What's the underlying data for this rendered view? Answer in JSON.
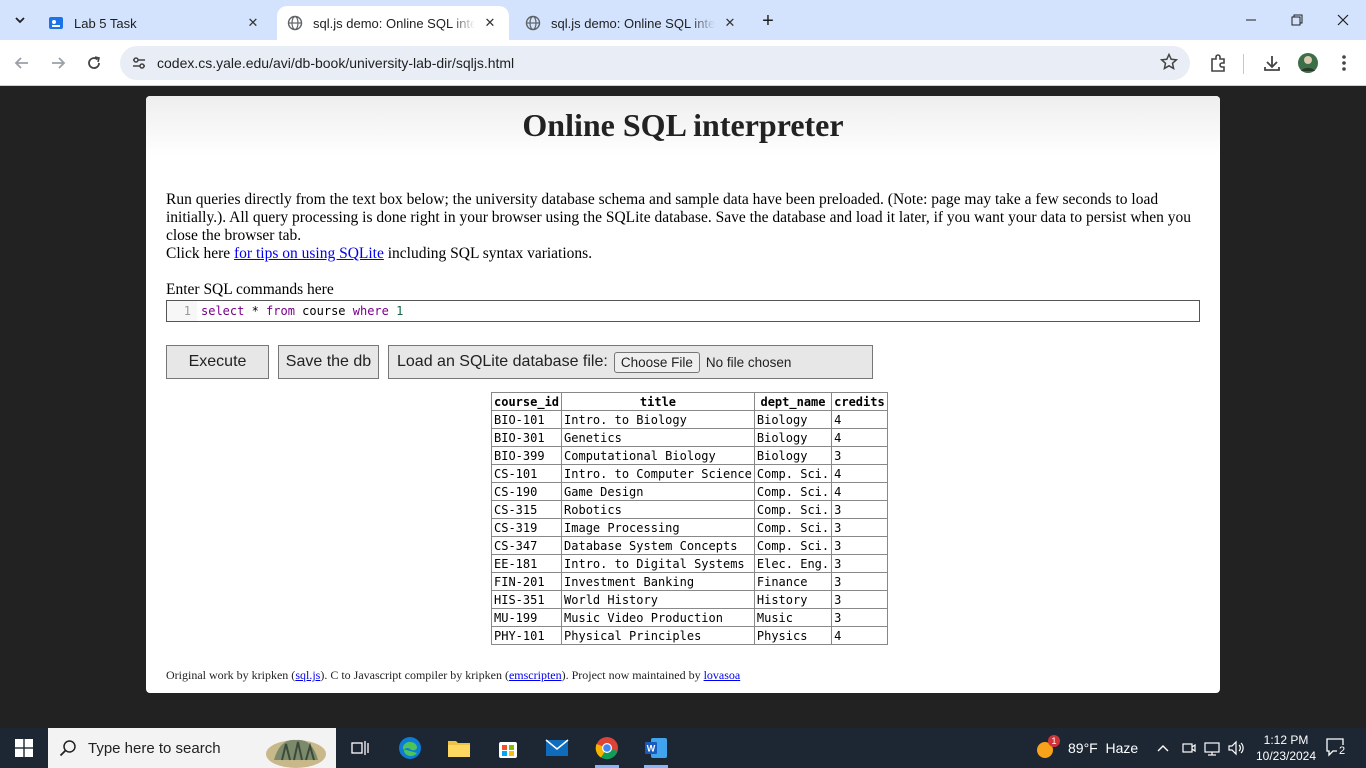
{
  "browser": {
    "tabs": [
      {
        "label": "Lab 5 Task",
        "active": false
      },
      {
        "label": "sql.js demo: Online SQL interpreter",
        "active": true
      },
      {
        "label": "sql.js demo: Online SQL interpreter",
        "active": false
      }
    ],
    "url": "codex.cs.yale.edu/avi/db-book/university-lab-dir/sqljs.html"
  },
  "page": {
    "title": "Online SQL interpreter",
    "intro_text": "Run queries directly from the text box below; the university database schema and sample data have been preloaded. (Note: page may take a few seconds to load initially.). All query processing is done right in your browser using the SQLite database. Save the database and load it later, if you want your data to persist when you close the browser tab.",
    "tips_prefix": "Click here ",
    "tips_link": "for tips on using SQLite",
    "tips_suffix": " including SQL syntax variations.",
    "editor_label": "Enter SQL commands here",
    "editor_line_number": "1",
    "editor_code": {
      "kw_select": "select",
      "star": " * ",
      "kw_from": "from",
      "table": " course ",
      "kw_where": "where",
      "space": " ",
      "num": "1"
    },
    "execute_label": "Execute",
    "save_label": "Save the db",
    "load_label": "Load an SQLite database file:",
    "choose_file_label": "Choose File",
    "no_file_text": "No file chosen"
  },
  "results": {
    "columns": [
      "course_id",
      "title",
      "dept_name",
      "credits"
    ],
    "rows": [
      [
        "BIO-101",
        "Intro. to Biology",
        "Biology",
        "4"
      ],
      [
        "BIO-301",
        "Genetics",
        "Biology",
        "4"
      ],
      [
        "BIO-399",
        "Computational Biology",
        "Biology",
        "3"
      ],
      [
        "CS-101",
        "Intro. to Computer Science",
        "Comp. Sci.",
        "4"
      ],
      [
        "CS-190",
        "Game Design",
        "Comp. Sci.",
        "4"
      ],
      [
        "CS-315",
        "Robotics",
        "Comp. Sci.",
        "3"
      ],
      [
        "CS-319",
        "Image Processing",
        "Comp. Sci.",
        "3"
      ],
      [
        "CS-347",
        "Database System Concepts",
        "Comp. Sci.",
        "3"
      ],
      [
        "EE-181",
        "Intro. to Digital Systems",
        "Elec. Eng.",
        "3"
      ],
      [
        "FIN-201",
        "Investment Banking",
        "Finance",
        "3"
      ],
      [
        "HIS-351",
        "World History",
        "History",
        "3"
      ],
      [
        "MU-199",
        "Music Video Production",
        "Music",
        "3"
      ],
      [
        "PHY-101",
        "Physical Principles",
        "Physics",
        "4"
      ]
    ]
  },
  "footer": {
    "t1": "Original work by kripken (",
    "l1": "sql.js",
    "t2": "). C to Javascript compiler by kripken (",
    "l2": "emscripten",
    "t3": "). Project now maintained by ",
    "l3": "lovasoa"
  },
  "taskbar": {
    "search_placeholder": "Type here to search",
    "weather_badge": "1",
    "weather_text": "89°F  Haze",
    "time": "1:12 PM",
    "date": "10/23/2024",
    "notification_count": "2"
  }
}
